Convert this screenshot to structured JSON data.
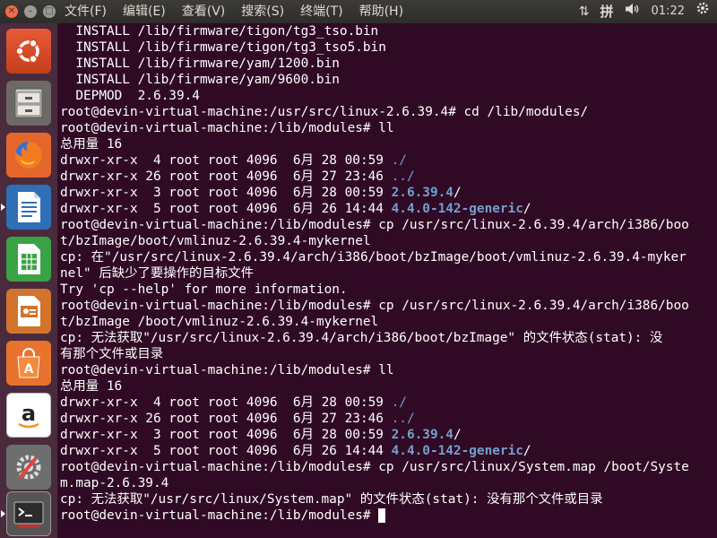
{
  "menubar": {
    "items": [
      "文件(F)",
      "编辑(E)",
      "查看(V)",
      "搜索(S)",
      "终端(T)",
      "帮助(H)"
    ]
  },
  "indicators": {
    "input_method": "拼",
    "clock": "01:22"
  },
  "launcher": {
    "items": [
      "ubuntu-dash",
      "files",
      "firefox",
      "libreoffice-writer",
      "libreoffice-calc",
      "libreoffice-impress",
      "ubuntu-software",
      "amazon",
      "system-settings",
      "terminal"
    ]
  },
  "terminal": {
    "lines": [
      [
        {
          "t": "  INSTALL /lib/firmware/tigon/tg3_tso.bin"
        }
      ],
      [
        {
          "t": "  INSTALL /lib/firmware/tigon/tg3_tso5.bin"
        }
      ],
      [
        {
          "t": "  INSTALL /lib/firmware/yam/1200.bin"
        }
      ],
      [
        {
          "t": "  INSTALL /lib/firmware/yam/9600.bin"
        }
      ],
      [
        {
          "t": "  DEPMOD  2.6.39.4"
        }
      ],
      [
        {
          "t": "root@devin-virtual-machine:/usr/src/linux-2.6.39.4# cd /lib/modules/"
        }
      ],
      [
        {
          "t": "root@devin-virtual-machine:/lib/modules# ll"
        }
      ],
      [
        {
          "t": "总用量 16"
        }
      ],
      [
        {
          "t": "drwxr-xr-x  4 root root 4096  6月 28 00:59 "
        },
        {
          "t": "./",
          "c": "dir"
        }
      ],
      [
        {
          "t": "drwxr-xr-x 26 root root 4096  6月 27 23:46 "
        },
        {
          "t": "../",
          "c": "dir"
        }
      ],
      [
        {
          "t": "drwxr-xr-x  3 root root 4096  6月 28 00:59 "
        },
        {
          "t": "2.6.39.4",
          "c": "dirb"
        },
        {
          "t": "/"
        }
      ],
      [
        {
          "t": "drwxr-xr-x  5 root root 4096  6月 26 14:44 "
        },
        {
          "t": "4.4.0-142-generic",
          "c": "dirb"
        },
        {
          "t": "/"
        }
      ],
      [
        {
          "t": "root@devin-virtual-machine:/lib/modules# cp /usr/src/linux-2.6.39.4/arch/i386/boo"
        }
      ],
      [
        {
          "t": "t/bzImage/boot/vmlinuz-2.6.39.4-mykernel"
        }
      ],
      [
        {
          "t": "cp: 在\"/usr/src/linux-2.6.39.4/arch/i386/boot/bzImage/boot/vmlinuz-2.6.39.4-myker"
        }
      ],
      [
        {
          "t": "nel\" 后缺少了要操作的目标文件"
        }
      ],
      [
        {
          "t": "Try 'cp --help' for more information."
        }
      ],
      [
        {
          "t": "root@devin-virtual-machine:/lib/modules# cp /usr/src/linux-2.6.39.4/arch/i386/boo"
        }
      ],
      [
        {
          "t": "t/bzImage /boot/vmlinuz-2.6.39.4-mykernel"
        }
      ],
      [
        {
          "t": "cp: 无法获取\"/usr/src/linux-2.6.39.4/arch/i386/boot/bzImage\" 的文件状态(stat): 没"
        }
      ],
      [
        {
          "t": "有那个文件或目录"
        }
      ],
      [
        {
          "t": "root@devin-virtual-machine:/lib/modules# ll"
        }
      ],
      [
        {
          "t": "总用量 16"
        }
      ],
      [
        {
          "t": "drwxr-xr-x  4 root root 4096  6月 28 00:59 "
        },
        {
          "t": "./",
          "c": "dir"
        }
      ],
      [
        {
          "t": "drwxr-xr-x 26 root root 4096  6月 27 23:46 "
        },
        {
          "t": "../",
          "c": "dir"
        }
      ],
      [
        {
          "t": "drwxr-xr-x  3 root root 4096  6月 28 00:59 "
        },
        {
          "t": "2.6.39.4",
          "c": "dirb"
        },
        {
          "t": "/"
        }
      ],
      [
        {
          "t": "drwxr-xr-x  5 root root 4096  6月 26 14:44 "
        },
        {
          "t": "4.4.0-142-generic",
          "c": "dirb"
        },
        {
          "t": "/"
        }
      ],
      [
        {
          "t": "root@devin-virtual-machine:/lib/modules# cp /usr/src/linux/System.map /boot/Syste"
        }
      ],
      [
        {
          "t": "m.map-2.6.39.4"
        }
      ],
      [
        {
          "t": "cp: 无法获取\"/usr/src/linux/System.map\" 的文件状态(stat): 没有那个文件或目录"
        }
      ],
      [
        {
          "t": "root@devin-virtual-machine:/lib/modules# "
        },
        {
          "cursor": true
        }
      ]
    ]
  },
  "colors": {
    "terminal_bg": "#300a24",
    "directory": "#729fcf",
    "close_button": "#ef6c45"
  }
}
